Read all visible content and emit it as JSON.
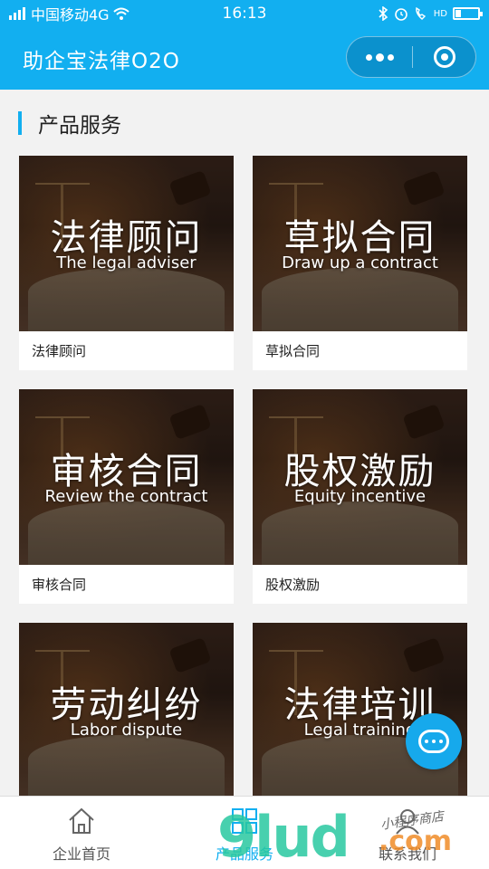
{
  "status_bar": {
    "carrier": "中国移动4G",
    "time": "16:13",
    "hd": "HD"
  },
  "navbar": {
    "title": "助企宝法律O2O"
  },
  "section": {
    "title": "产品服务"
  },
  "cards": [
    {
      "cn": "法律顾问",
      "en": "The legal adviser",
      "label": "法律顾问"
    },
    {
      "cn": "草拟合同",
      "en": "Draw up a contract",
      "label": "草拟合同"
    },
    {
      "cn": "审核合同",
      "en": "Review the contract",
      "label": "审核合同"
    },
    {
      "cn": "股权激励",
      "en": "Equity incentive",
      "label": "股权激励"
    },
    {
      "cn": "劳动纠纷",
      "en": "Labor dispute",
      "label": ""
    },
    {
      "cn": "法律培训",
      "en": "Legal training",
      "label": ""
    }
  ],
  "tabbar": {
    "home": "企业首页",
    "products": "产品服务",
    "contact": "联系我们",
    "active": "products"
  },
  "watermark": {
    "logo": "9lud",
    "com": ".com",
    "shop": "小程序商店"
  },
  "colors": {
    "accent": "#12aff0",
    "fab": "#16a9ec"
  },
  "icons": {
    "fab": "chat-bubble-icon",
    "home": "house-icon",
    "products": "grid-icon",
    "contact": "person-icon"
  }
}
